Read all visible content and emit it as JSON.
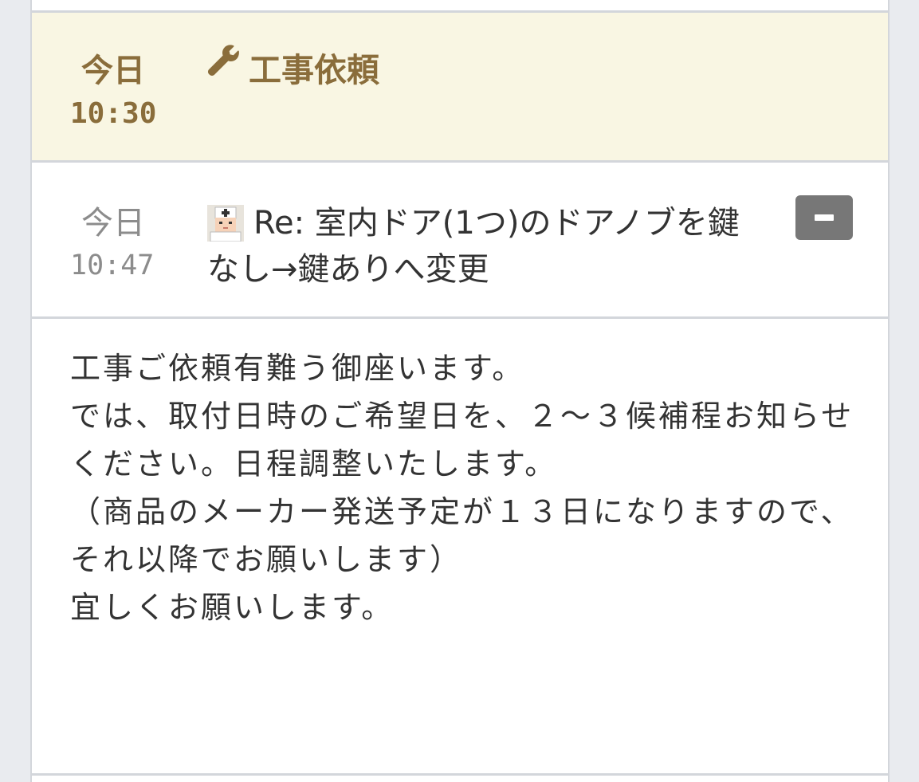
{
  "event": {
    "day": "今日",
    "time": "10:30",
    "title": "工事依頼",
    "icon": "wrench-icon",
    "color": "#8a6d3b",
    "background": "#f9f6e3"
  },
  "message": {
    "day": "今日",
    "time": "10:47",
    "avatar": "worker-avatar-icon",
    "subject": "Re: 室内ドア(1つ)のドアノブを鍵なし→鍵ありへ変更",
    "collapse_icon": "minus-icon",
    "body": [
      "工事ご依頼有難う御座います。",
      "",
      "では、取付日時のご希望日を、２～３候補程お知らせください。日程調整いたします。",
      "（商品のメーカー発送予定が１３日になりますので、それ以降でお願いします）",
      "",
      "宜しくお願いします。"
    ]
  }
}
